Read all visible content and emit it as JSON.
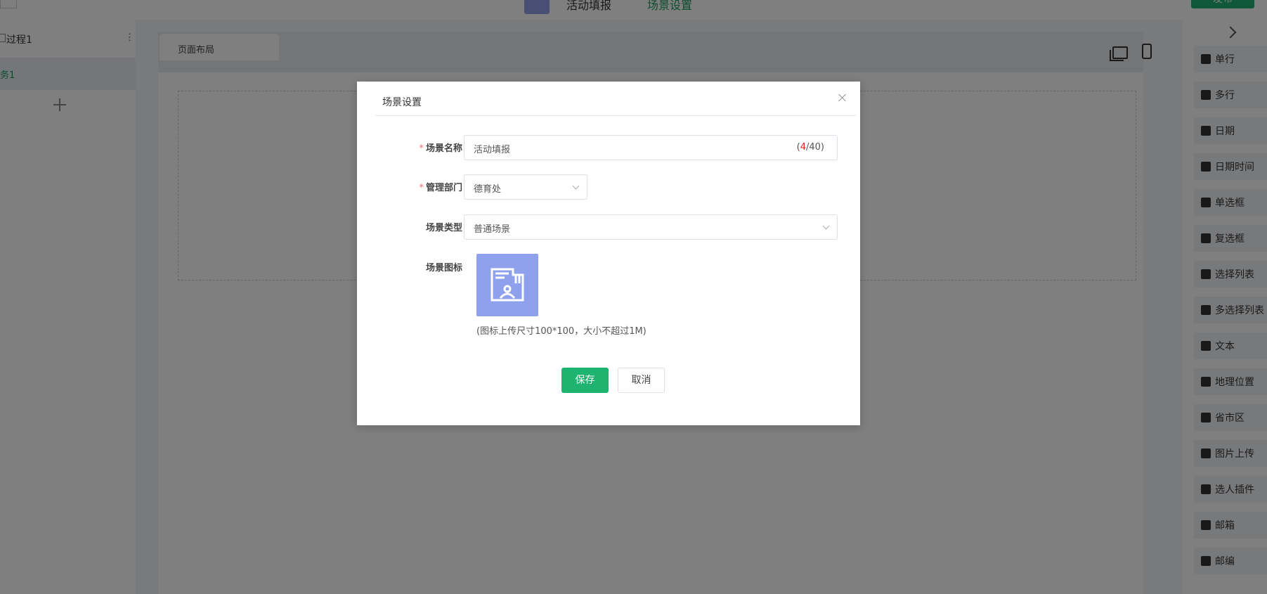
{
  "topbar": {
    "tab_active": "活动填报",
    "tab_scene": "场景设置",
    "publish_label": "发布"
  },
  "left_panel": {
    "process_label": "过程1",
    "task_label": "务1"
  },
  "canvas": {
    "tab_label": "页面布局"
  },
  "widgets": [
    {
      "label": "单行",
      "icon": "text-single-icon"
    },
    {
      "label": "多行",
      "icon": "text-multi-icon"
    },
    {
      "label": "日期",
      "icon": "calendar-icon"
    },
    {
      "label": "日期时间",
      "icon": "calendar-time-icon"
    },
    {
      "label": "单选框",
      "icon": "radio-icon"
    },
    {
      "label": "复选框",
      "icon": "checkbox-icon"
    },
    {
      "label": "选择列表",
      "icon": "grid-icon"
    },
    {
      "label": "多选择列表",
      "icon": "list-icon"
    },
    {
      "label": "文本",
      "icon": "edit-icon"
    },
    {
      "label": "地理位置",
      "icon": "location-icon"
    },
    {
      "label": "省市区",
      "icon": "map-icon"
    },
    {
      "label": "图片上传",
      "icon": "image-icon"
    },
    {
      "label": "选人插件",
      "icon": "person-card-icon"
    },
    {
      "label": "邮箱",
      "icon": "mail-icon"
    },
    {
      "label": "邮编",
      "icon": "postcode-icon"
    }
  ],
  "dialog": {
    "title": "场景设置",
    "name_label": "场景名称",
    "name_value": "活动填报",
    "name_count_current": "4",
    "name_count_max": "/40)",
    "name_count_open": "(",
    "dept_label": "管理部门",
    "dept_value": "德育处",
    "type_label": "场景类型",
    "type_value": "普通场景",
    "icon_label": "场景图标",
    "icon_hint": "(图标上传尺寸100*100，大小不超过1M)",
    "save_label": "保存",
    "cancel_label": "取消"
  },
  "colors": {
    "accent_green": "#1fb370",
    "icon_blue": "#8fa0ec",
    "required_red": "#f56c6c"
  }
}
